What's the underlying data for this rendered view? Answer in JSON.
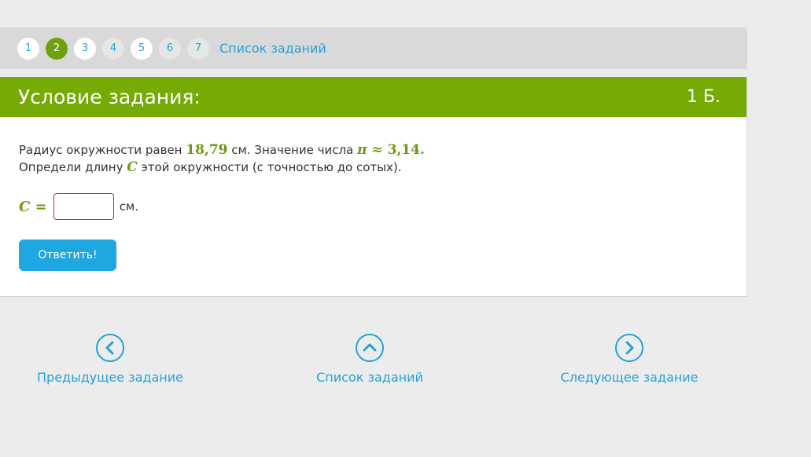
{
  "pager": {
    "pages": [
      {
        "label": "1",
        "state": "default"
      },
      {
        "label": "2",
        "state": "active"
      },
      {
        "label": "3",
        "state": "default"
      },
      {
        "label": "4",
        "state": "muted"
      },
      {
        "label": "5",
        "state": "default"
      },
      {
        "label": "6",
        "state": "muted"
      },
      {
        "label": "7",
        "state": "muted"
      }
    ],
    "list_link": "Список заданий"
  },
  "task": {
    "header_title": "Условие задания:",
    "points": "1 Б.",
    "line1_pre": "Радиус окружности равен ",
    "radius": "18,79",
    "line1_mid": " см. Значение числа ",
    "pi_symbol": "π",
    "approx": " ≈ ",
    "pi_value": "3,14.",
    "line2_pre": "Определи длину ",
    "var_c": "C",
    "line2_post": " этой окружности (с точностью до сотых).",
    "answer_label": "C =",
    "answer_value": "",
    "unit": "см.",
    "submit_label": "Ответить!"
  },
  "nav": {
    "prev_label": "Предыдущее задание",
    "list_label": "Список заданий",
    "next_label": "Следующее задание"
  },
  "colors": {
    "accent_green": "#76aa04",
    "link_blue": "#22a3d9",
    "button_blue": "#1ea7e1",
    "input_border": "#c2187b"
  }
}
